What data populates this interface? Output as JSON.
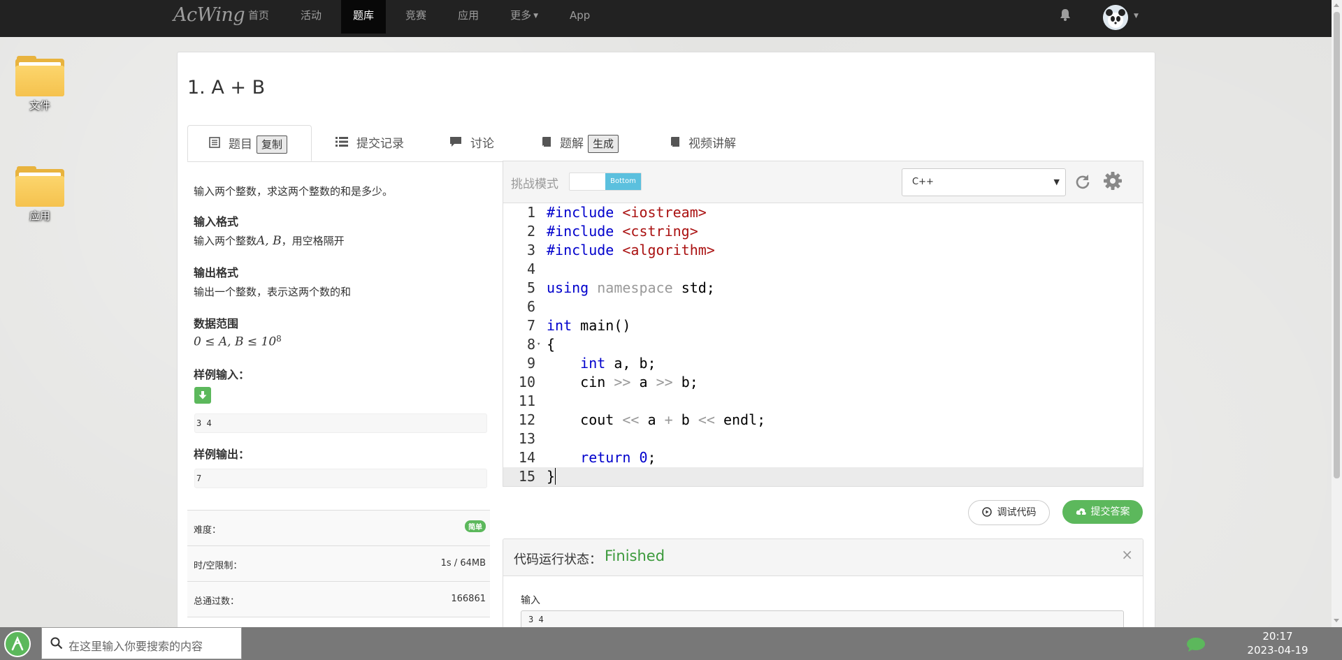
{
  "navbar": {
    "brand": "AcWing",
    "items": [
      {
        "label": "首页"
      },
      {
        "label": "活动"
      },
      {
        "label": "题库"
      },
      {
        "label": "竞赛"
      },
      {
        "label": "应用"
      },
      {
        "label": "更多"
      },
      {
        "label": "App"
      }
    ],
    "active_item": "题库"
  },
  "desktop": {
    "icons": [
      {
        "label": "文件"
      },
      {
        "label": "应用"
      }
    ]
  },
  "problem": {
    "title": "1. A + B",
    "tabs": [
      {
        "label": "题目",
        "button": "复制"
      },
      {
        "label": "提交记录"
      },
      {
        "label": "讨论"
      },
      {
        "label": "题解",
        "button": "生成"
      },
      {
        "label": "视频讲解"
      }
    ],
    "description": "输入两个整数，求这两个整数的和是多少。",
    "input_format_head": "输入格式",
    "input_format_pre": "输入两个整数",
    "input_format_math": "A, B",
    "input_format_post": "，用空格隔开",
    "output_format_head": "输出格式",
    "output_format": "输出一个整数，表示这两个数的和",
    "range_head": "数据范围",
    "range_math": "0 ≤ A, B ≤ 10",
    "range_exp": "8",
    "sample_input_head": "样例输入：",
    "sample_input": "3 4",
    "sample_output_head": "样例输出：",
    "sample_output": "7"
  },
  "info": {
    "difficulty_label": "难度：",
    "difficulty": "简单",
    "limit_label": "时/空限制：",
    "limit": "1s / 64MB",
    "passed_label": "总通过数：",
    "passed": "166861"
  },
  "editor": {
    "mode_label": "挑战模式",
    "toggle_label": "Bottom",
    "language": "C++",
    "current_line": 15,
    "lines": [
      {
        "n": "1"
      },
      {
        "n": "2"
      },
      {
        "n": "3"
      },
      {
        "n": "4"
      },
      {
        "n": "5"
      },
      {
        "n": "6"
      },
      {
        "n": "7"
      },
      {
        "n": "8"
      },
      {
        "n": "9"
      },
      {
        "n": "10"
      },
      {
        "n": "11"
      },
      {
        "n": "12"
      },
      {
        "n": "13"
      },
      {
        "n": "14"
      },
      {
        "n": "15"
      }
    ],
    "code": {
      "l1a": "#include",
      "l1b": "<iostream>",
      "l2a": "#include",
      "l2b": "<cstring>",
      "l3a": "#include",
      "l3b": "<algorithm>",
      "l5a": "using",
      "l5b": "namespace",
      "l5c": "std;",
      "l7a": "int",
      "l7b": "main()",
      "l8": "{",
      "l9a": "int",
      "l9b": "a, b;",
      "l10a": "cin",
      "l10b": ">>",
      "l10c": "a",
      "l10d": ">>",
      "l10e": "b;",
      "l12a": "cout",
      "l12b": "<<",
      "l12c": "a",
      "l12d": "+",
      "l12e": "b",
      "l12f": "<<",
      "l12g": "endl;",
      "l14a": "return",
      "l14b": "0",
      "l14c": ";",
      "l15": "}"
    }
  },
  "actions": {
    "debug": "调试代码",
    "submit": "提交答案"
  },
  "run_status": {
    "label": "代码运行状态：",
    "value": "Finished",
    "close": "×",
    "input_label": "输入",
    "input_value": "3 4"
  },
  "taskbar": {
    "search_placeholder": "在这里输入你要搜索的内容",
    "time": "20:17",
    "date": "2023-04-19"
  },
  "colors": {
    "navbar": "#222222",
    "success": "#5cb85c",
    "info": "#5bc0de",
    "finished": "#3c9a3c"
  }
}
